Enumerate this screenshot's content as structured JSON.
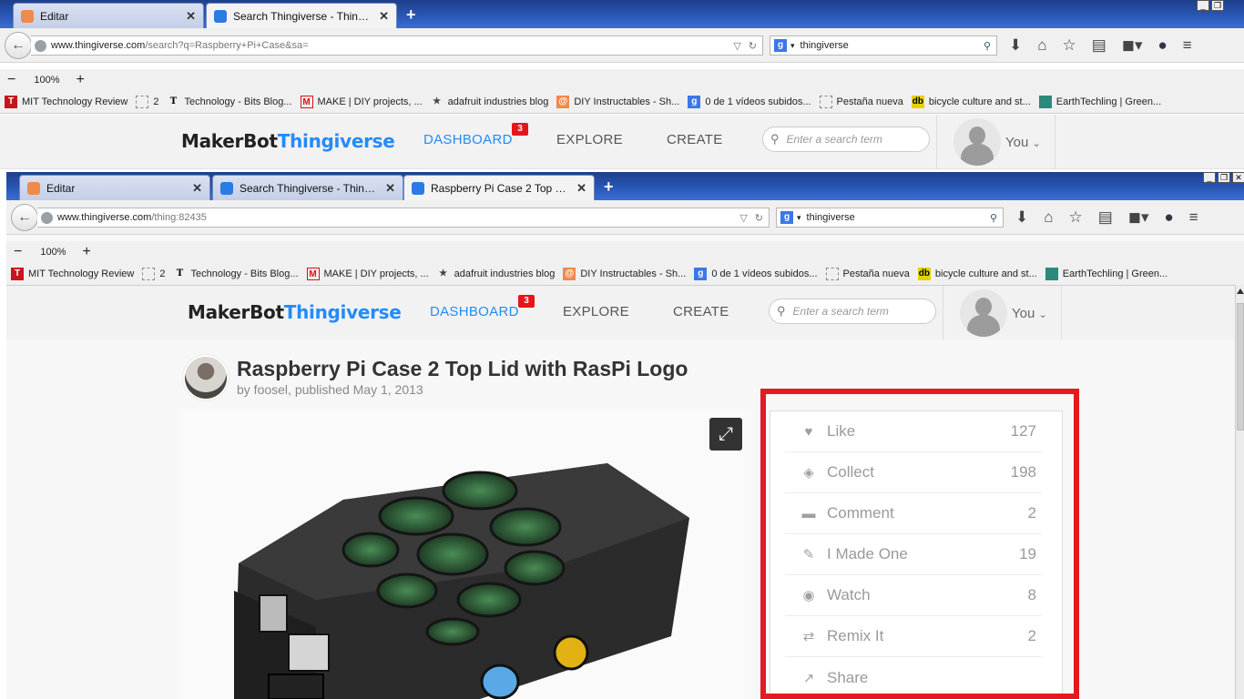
{
  "back_window": {
    "tabs": [
      {
        "label": "Editar",
        "icon": "instructables-icon",
        "color": "#f08a4b"
      },
      {
        "label": "Search Thingiverse - Thingive...",
        "icon": "thingiverse-icon",
        "color": "#2a7be4"
      }
    ],
    "url_host": "www.thingiverse.com",
    "url_path": "/search?q=Raspberry+Pi+Case&sa=",
    "search_value": "thingiverse",
    "zoom": "100%"
  },
  "front_window": {
    "tabs": [
      {
        "label": "Editar",
        "icon": "instructables-icon",
        "color": "#f08a4b"
      },
      {
        "label": "Search Thingiverse - Thingive...",
        "icon": "thingiverse-icon",
        "color": "#2a7be4"
      },
      {
        "label": "Raspberry Pi Case 2 Top Lid ...",
        "icon": "thingiverse-icon",
        "color": "#2a7be4"
      }
    ],
    "url_host": "www.thingiverse.com",
    "url_path": "/thing:82435",
    "search_value": "thingiverse",
    "zoom": "100%"
  },
  "bookmarks": [
    {
      "label": "MIT Technology Review",
      "icon": "mit-icon"
    },
    {
      "label": "2",
      "icon": "blank-page-icon"
    },
    {
      "label": "Technology - Bits Blog...",
      "icon": "nyt-icon"
    },
    {
      "label": "MAKE | DIY projects, ...",
      "icon": "make-icon"
    },
    {
      "label": "adafruit industries blog",
      "icon": "adafruit-icon"
    },
    {
      "label": "DIY Instructables - Sh...",
      "icon": "instructables-icon"
    },
    {
      "label": "0 de 1 vídeos subidos...",
      "icon": "google-icon"
    },
    {
      "label": "Pestaña nueva",
      "icon": "blank-page-icon"
    },
    {
      "label": "bicycle culture and st...",
      "icon": "db-icon"
    },
    {
      "label": "EarthTechling | Green...",
      "icon": "earthtechling-icon"
    }
  ],
  "thingiverse": {
    "logo_makerbot": "MakerBot",
    "logo_thingiverse": "Thingiverse",
    "nav": {
      "dashboard": "DASHBOARD",
      "explore": "EXPLORE",
      "create": "CREATE"
    },
    "notifications": "3",
    "search_placeholder": "Enter a search term",
    "user_label": "You"
  },
  "thing": {
    "title": "Raspberry Pi Case 2 Top Lid with RasPi Logo",
    "byline": "by foosel, published May 1, 2013"
  },
  "stats": [
    {
      "label": "Like",
      "count": "127",
      "icon": "heart-icon"
    },
    {
      "label": "Collect",
      "count": "198",
      "icon": "collect-icon"
    },
    {
      "label": "Comment",
      "count": "2",
      "icon": "comment-icon"
    },
    {
      "label": "I Made One",
      "count": "19",
      "icon": "made-one-icon"
    },
    {
      "label": "Watch",
      "count": "8",
      "icon": "eye-icon"
    },
    {
      "label": "Remix It",
      "count": "2",
      "icon": "remix-icon"
    },
    {
      "label": "Share",
      "count": "",
      "icon": "share-icon"
    }
  ],
  "colors": {
    "accent": "#248bfb",
    "highlight_box": "#e31a24",
    "badge": "#e8141b"
  }
}
